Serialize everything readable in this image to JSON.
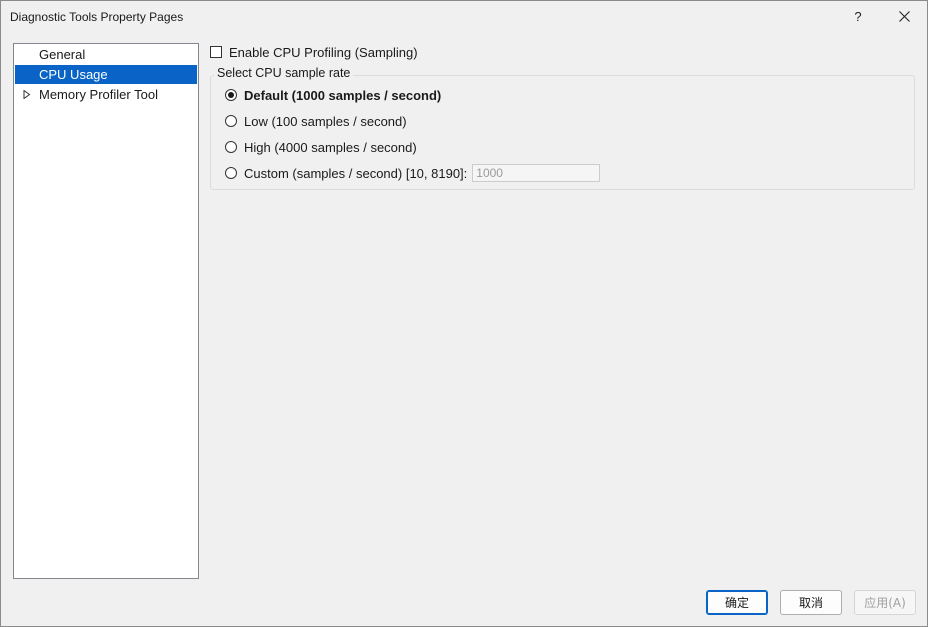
{
  "window": {
    "title": "Diagnostic Tools Property Pages",
    "help_label": "?"
  },
  "nav": {
    "items": [
      {
        "label": "General",
        "selected": false,
        "expandable": false
      },
      {
        "label": "CPU Usage",
        "selected": true,
        "expandable": false
      },
      {
        "label": "Memory Profiler Tool",
        "selected": false,
        "expandable": true
      }
    ]
  },
  "cpu": {
    "enable_label": "Enable CPU Profiling (Sampling)",
    "enable_checked": false,
    "group_title": "Select CPU sample rate",
    "options": [
      {
        "label": "Default (1000 samples / second)",
        "checked": true
      },
      {
        "label": "Low (100 samples / second)",
        "checked": false
      },
      {
        "label": "High (4000 samples / second)",
        "checked": false
      },
      {
        "label": "Custom (samples / second) [10, 8190]:",
        "checked": false
      }
    ],
    "custom_value": "1000"
  },
  "buttons": {
    "ok": "确定",
    "cancel": "取消",
    "apply": "应用(A)"
  },
  "colors": {
    "selection": "#0a64c8",
    "background": "#f0f0f0"
  }
}
